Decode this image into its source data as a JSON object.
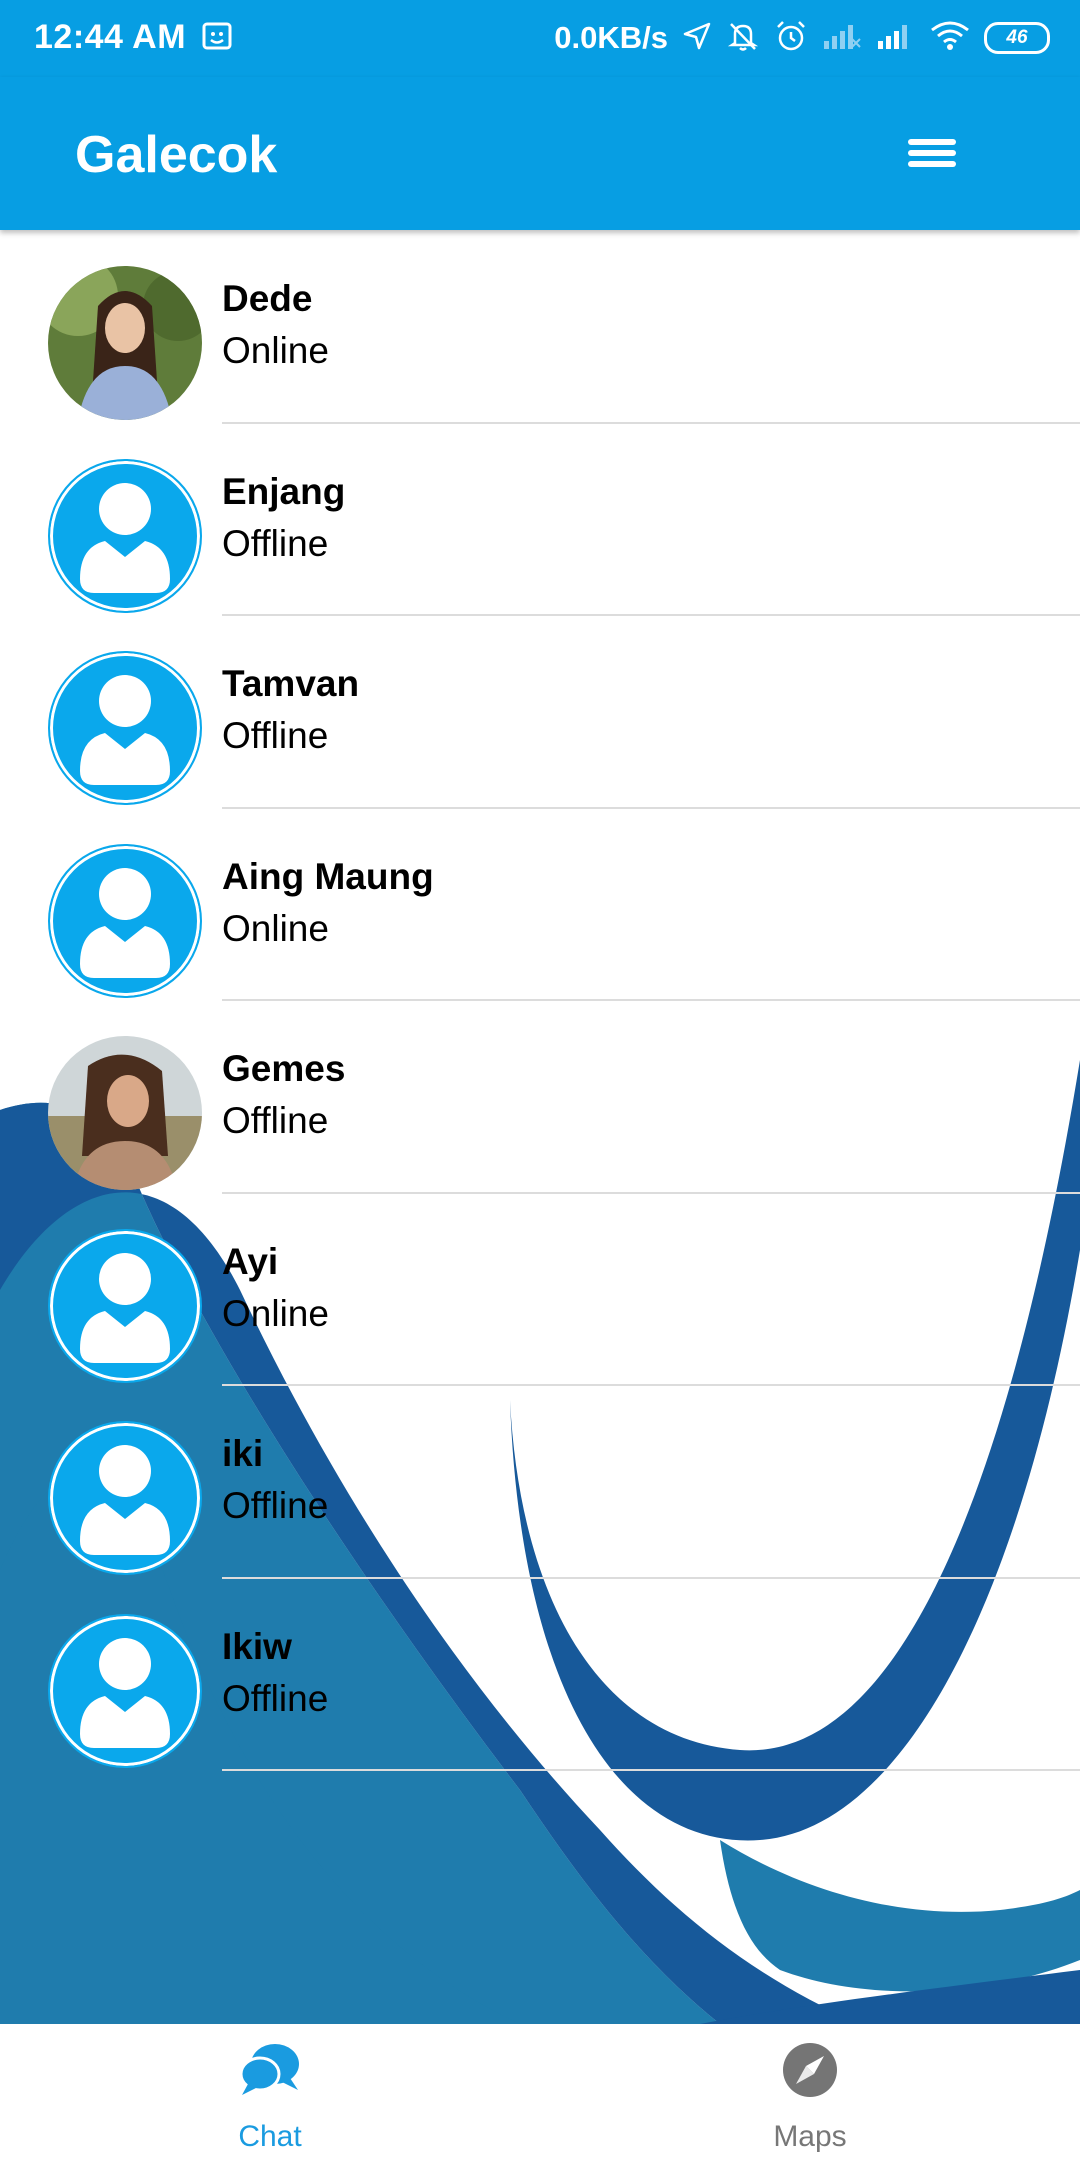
{
  "status_bar": {
    "time": "12:44 AM",
    "net_speed": "0.0KB/s",
    "battery": "46"
  },
  "app": {
    "title": "Galecok",
    "menu_icon": "hamburger-menu-icon"
  },
  "colors": {
    "primary": "#079ee3",
    "avatar_blue": "#0aa8ec",
    "wave_dark": "#17599a",
    "wave_light": "#1f7cad"
  },
  "contacts": [
    {
      "name": "Dede",
      "status": "Online",
      "avatar": "photo"
    },
    {
      "name": "Enjang",
      "status": "Offline",
      "avatar": "default"
    },
    {
      "name": "Tamvan",
      "status": "Offline",
      "avatar": "default"
    },
    {
      "name": "Aing Maung",
      "status": "Online",
      "avatar": "default"
    },
    {
      "name": "Gemes",
      "status": "Offline",
      "avatar": "photo"
    },
    {
      "name": "Ayi",
      "status": "Online",
      "avatar": "default"
    },
    {
      "name": "iki",
      "status": "Offline",
      "avatar": "default"
    },
    {
      "name": "Ikiw",
      "status": "Offline",
      "avatar": "default"
    }
  ],
  "bottom_nav": {
    "chat_label": "Chat",
    "maps_label": "Maps",
    "active": "Chat"
  }
}
